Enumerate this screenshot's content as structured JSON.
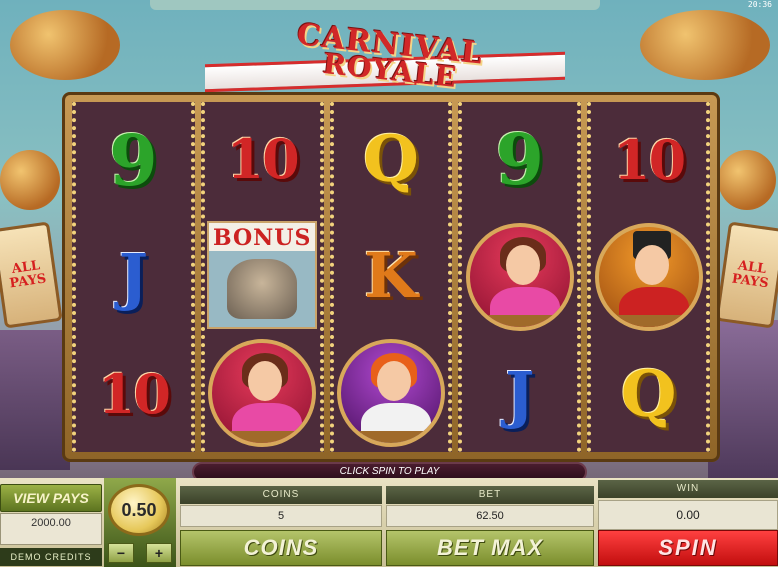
{
  "clock": "20:36",
  "title": {
    "line1": "CARNIVAL",
    "line2": "ROYALE"
  },
  "side_signs": {
    "left": [
      "ALL",
      "PAYS"
    ],
    "right": [
      "ALL",
      "PAYS"
    ]
  },
  "reels": [
    [
      {
        "type": "nine",
        "label": "9"
      },
      {
        "type": "jack",
        "label": "J"
      },
      {
        "type": "ten",
        "label": "10"
      }
    ],
    [
      {
        "type": "ten",
        "label": "10"
      },
      {
        "type": "bonus",
        "label": "BONUS"
      },
      {
        "type": "lady",
        "label": ""
      }
    ],
    [
      {
        "type": "queen",
        "label": "Q"
      },
      {
        "type": "king",
        "label": "K"
      },
      {
        "type": "clown",
        "label": ""
      }
    ],
    [
      {
        "type": "nine",
        "label": "9"
      },
      {
        "type": "lady",
        "label": ""
      },
      {
        "type": "jack",
        "label": "J"
      }
    ],
    [
      {
        "type": "ten",
        "label": "10"
      },
      {
        "type": "ringmaster",
        "label": ""
      },
      {
        "type": "queen",
        "label": "Q"
      }
    ]
  ],
  "message": "CLICK SPIN TO PLAY",
  "controls": {
    "view_pays": "VIEW PAYS",
    "credits_value": "2000.00",
    "credits_label": "DEMO CREDITS",
    "coin_size": "0.50",
    "minus": "−",
    "plus": "+",
    "coins_header": "COINS",
    "coins_value": "5",
    "bet_header": "BET",
    "bet_value": "62.50",
    "win_header": "WIN",
    "win_value": "0.00",
    "coins_button": "COINS",
    "bet_max_button": "BET MAX",
    "spin_button": "SPIN"
  }
}
